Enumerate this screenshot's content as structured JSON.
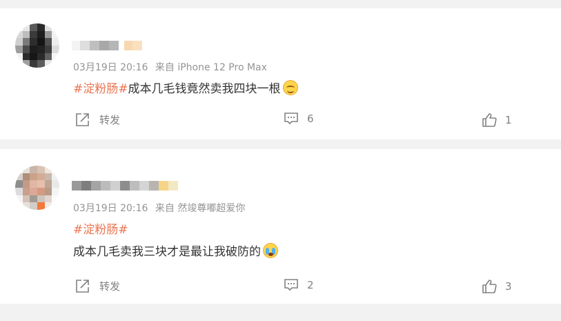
{
  "comments": [
    {
      "meta": {
        "date": "03月19日 20:16",
        "source": "来自 iPhone 12 Pro Max"
      },
      "text_segments": {
        "hashtag": "#淀粉肠#",
        "body": "成本几毛钱竟然卖我四块一根"
      },
      "emoji": "smiling-face-emoji",
      "actions": {
        "share_label": "转发",
        "comment_count": "6",
        "like_count": "1"
      }
    },
    {
      "meta": {
        "date": "03月19日 20:16",
        "source": "来自 然竣尊嘟超爱你"
      },
      "text_segments": {
        "hashtag": "#淀粉肠#",
        "body": "成本几毛卖我三块才是最让我破防的"
      },
      "emoji": "crying-face-emoji",
      "actions": {
        "share_label": "转发",
        "comment_count": "2",
        "like_count": "3"
      }
    }
  ],
  "colors": {
    "hashtag": "#eb7350",
    "meta": "#939393",
    "text": "#333333",
    "action": "#808080",
    "background": "#f2f2f2"
  }
}
